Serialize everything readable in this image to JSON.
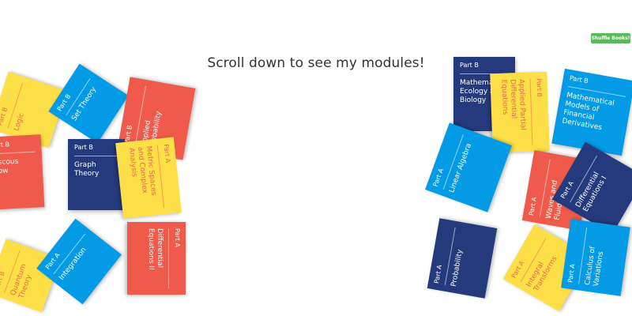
{
  "header": {
    "scroll_prompt": "Scroll down to see my modules!"
  },
  "shuffle_button": {
    "label": "Shuffle Books!",
    "color": "#5cb85c"
  },
  "palette": {
    "red": "#f05a4a",
    "blue": "#039be5",
    "navy": "#253a7d",
    "yellow": "#fde047",
    "yellow_text": "#e8684a"
  },
  "books": [
    {
      "part": "Part B",
      "title": "Logic",
      "color": "yellow"
    },
    {
      "part": "Part B",
      "title": "Set Theory",
      "color": "blue"
    },
    {
      "part": "Part B",
      "title": "Applied Probability",
      "color": "red"
    },
    {
      "part": "Part B",
      "title": "Viscous Flow",
      "color": "red"
    },
    {
      "part": "Part B",
      "title": "Graph Theory",
      "color": "navy"
    },
    {
      "part": "Part A",
      "title": "Metric Spaces and Complex Analysis",
      "color": "yellow"
    },
    {
      "part": "Part B",
      "title": "Quantum Theory",
      "color": "yellow"
    },
    {
      "part": "Part A",
      "title": "Integration",
      "color": "blue"
    },
    {
      "part": "Part A",
      "title": "Differential Equations II",
      "color": "red"
    },
    {
      "part": "Part B",
      "title": "Mathematical Ecology and Biology",
      "color": "navy"
    },
    {
      "part": "Part B",
      "title": "Applied Partial Differential Equations",
      "color": "yellow"
    },
    {
      "part": "Part B",
      "title": "Mathematical Models of Financial Derivatives",
      "color": "blue"
    },
    {
      "part": "Part A",
      "title": "Linear Algebra",
      "color": "blue"
    },
    {
      "part": "Part A",
      "title": "Waves and Fluids",
      "color": "red"
    },
    {
      "part": "Part A",
      "title": "Differential Equations I",
      "color": "navy"
    },
    {
      "part": "Part A",
      "title": "Probability",
      "color": "navy"
    },
    {
      "part": "Part A",
      "title": "Integral Transforms",
      "color": "yellow"
    },
    {
      "part": "Part A",
      "title": "Calculus of Variations",
      "color": "blue"
    }
  ]
}
